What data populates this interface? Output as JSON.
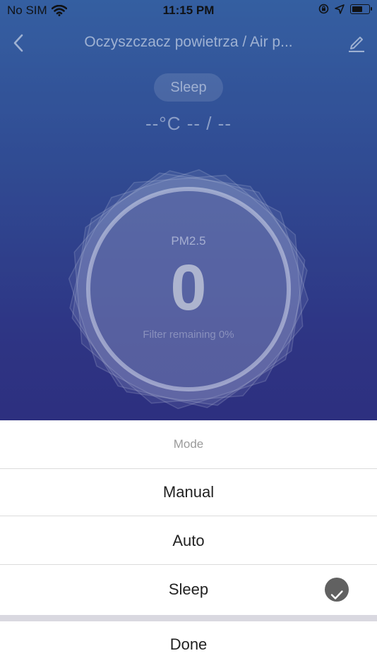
{
  "status_bar": {
    "carrier": "No SIM",
    "time": "11:15 PM",
    "icons": [
      "wifi-icon",
      "orientation-lock-icon",
      "location-icon",
      "battery-icon"
    ]
  },
  "nav": {
    "title": "Oczyszczacz powietrza / Air p...",
    "back_icon": "chevron-left-icon",
    "edit_icon": "pencil-icon"
  },
  "device": {
    "mode": "Sleep",
    "temperature_humidity": "--°C -- / --",
    "pm_label": "PM2.5",
    "pm_value": "0",
    "filter_text": "Filter remaining 0%"
  },
  "sheet": {
    "title": "Mode",
    "options": [
      {
        "label": "Manual",
        "selected": false
      },
      {
        "label": "Auto",
        "selected": false
      },
      {
        "label": "Sleep",
        "selected": true
      }
    ],
    "done_label": "Done"
  },
  "colors": {
    "bg_top": "#3a68b0",
    "bg_bottom": "#2f2278",
    "check": "#616161"
  }
}
